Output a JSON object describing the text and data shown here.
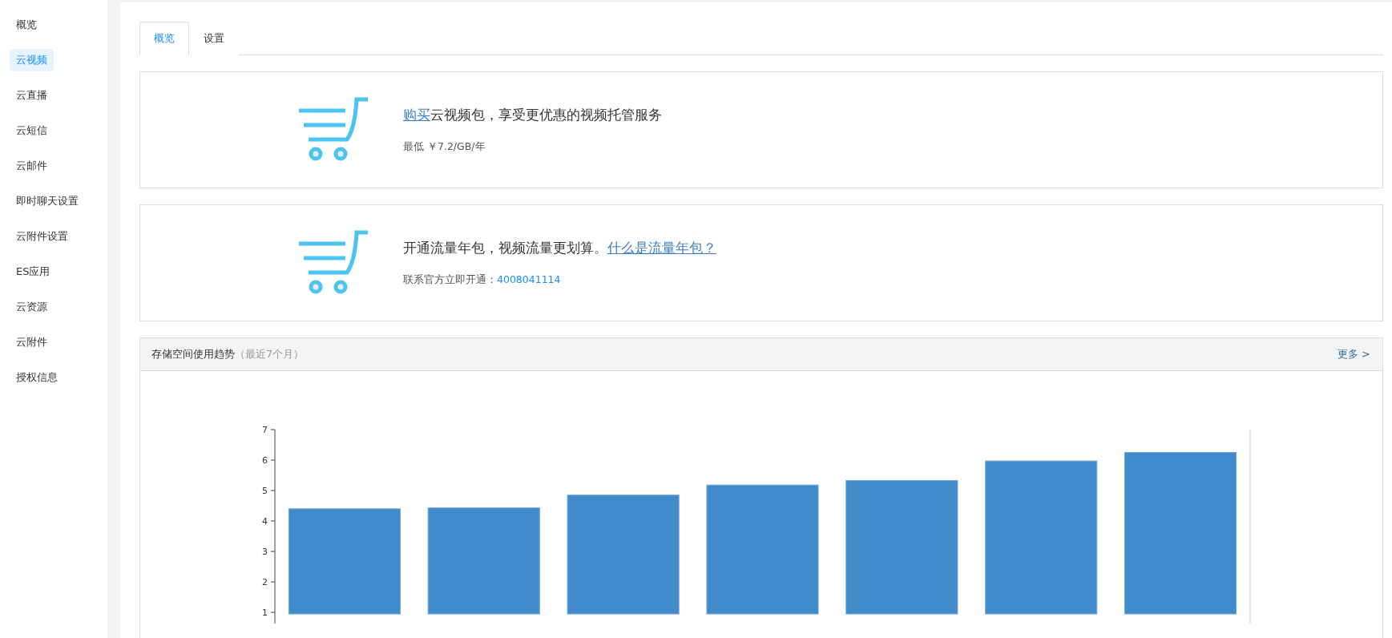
{
  "sidebar": {
    "items": [
      {
        "label": "概览",
        "selected": false
      },
      {
        "label": "云视频",
        "selected": true
      },
      {
        "label": "云直播",
        "selected": false
      },
      {
        "label": "云短信",
        "selected": false
      },
      {
        "label": "云邮件",
        "selected": false
      },
      {
        "label": "即时聊天设置",
        "selected": false
      },
      {
        "label": "云附件设置",
        "selected": false
      },
      {
        "label": "ES应用",
        "selected": false
      },
      {
        "label": "云资源",
        "selected": false
      },
      {
        "label": "云附件",
        "selected": false
      },
      {
        "label": "授权信息",
        "selected": false
      }
    ]
  },
  "tabs": [
    {
      "label": "概览",
      "selected": true
    },
    {
      "label": "设置",
      "selected": false
    }
  ],
  "promos": [
    {
      "title": [
        {
          "kind": "link",
          "text": "购买"
        },
        {
          "kind": "text",
          "text": "云视频包，享受更优惠的视频托管服务"
        }
      ],
      "note": [
        {
          "kind": "text",
          "text": "最低 ￥7.2/GB/年"
        }
      ]
    },
    {
      "title": [
        {
          "kind": "text",
          "text": "开通流量年包，视频流量更划算。"
        },
        {
          "kind": "link",
          "text": "什么是流量年包？"
        }
      ],
      "note": [
        {
          "kind": "text",
          "text": "联系官方立即开通："
        },
        {
          "kind": "phone",
          "text": "4008041114"
        }
      ]
    }
  ],
  "storage_panel": {
    "title": "存储空间使用趋势",
    "subtitle": "（最近7个月）",
    "more_link": "更多 >",
    "chart_data": {
      "type": "bar",
      "ylim": [
        1,
        7
      ],
      "yticks": [
        1,
        2,
        3,
        4,
        5,
        6,
        7
      ],
      "series": [
        {
          "color": "#428bca",
          "values": [
            4.4,
            4.43,
            4.85,
            5.18,
            5.33,
            5.97,
            6.25
          ]
        }
      ]
    }
  }
}
